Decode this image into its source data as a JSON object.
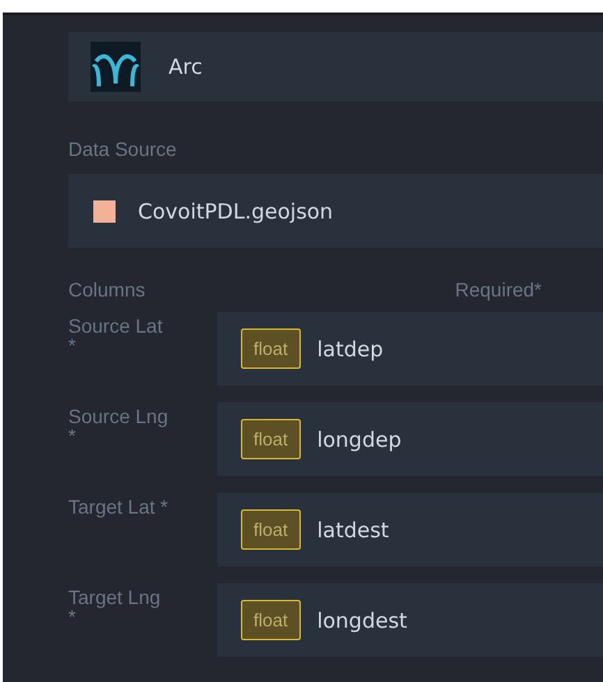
{
  "layer": {
    "type_label": "Arc"
  },
  "data_source": {
    "heading": "Data Source",
    "dataset": "CovoitPDL.geojson",
    "color": "#f4b19a"
  },
  "columns": {
    "heading": "Columns",
    "required_heading": "Required*",
    "rows": [
      {
        "label": "Source Lat\n*",
        "type": "float",
        "field": "latdep"
      },
      {
        "label": "Source Lng\n*",
        "type": "float",
        "field": "longdep"
      },
      {
        "label": "Target Lat *",
        "type": "float",
        "field": "latdest"
      },
      {
        "label": "Target Lng\n*",
        "type": "float",
        "field": "longdest"
      }
    ]
  }
}
